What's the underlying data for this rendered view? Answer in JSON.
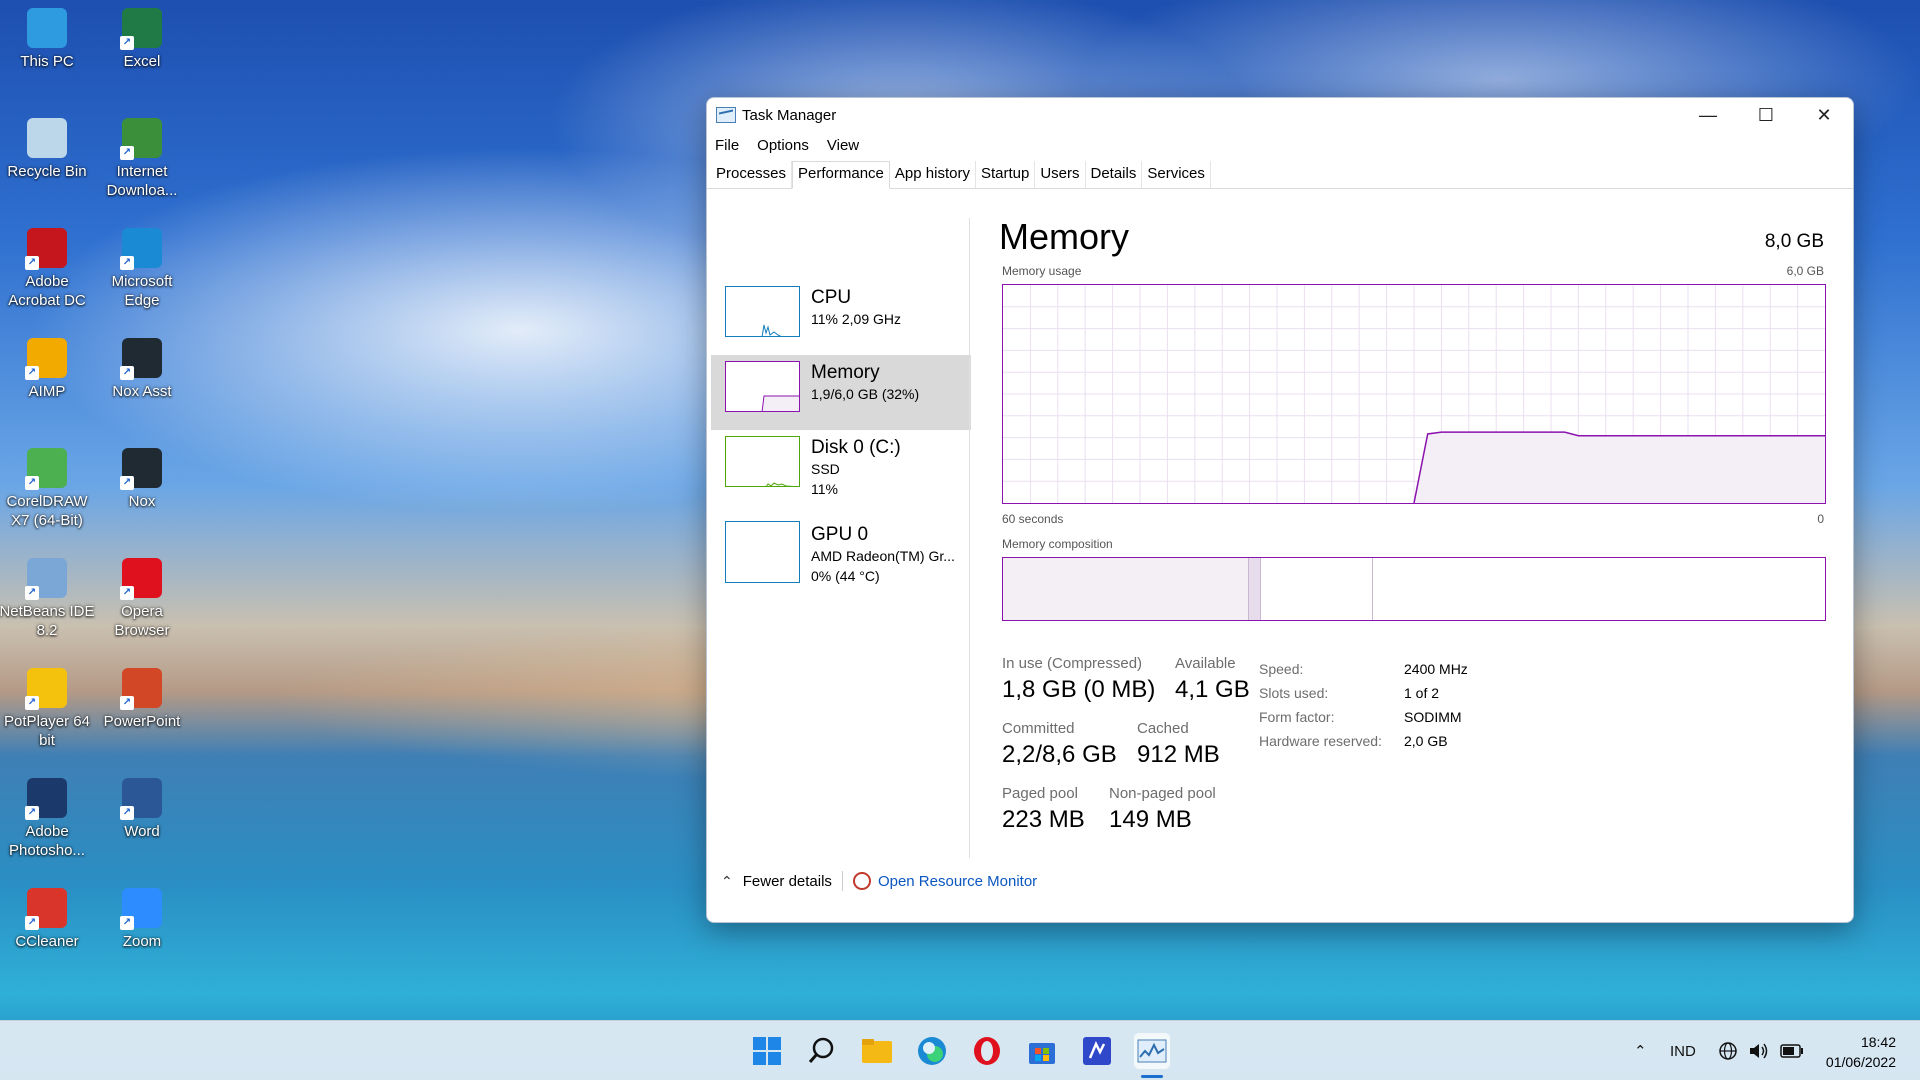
{
  "desktop": {
    "icons": [
      {
        "label": "This PC",
        "icon": "computer-icon",
        "color": "#2e9ae0"
      },
      {
        "label": "Excel",
        "icon": "excel-icon",
        "color": "#1f7a45"
      },
      {
        "label": "Recycle Bin",
        "icon": "recycle-bin-icon",
        "color": "#bcd6ea"
      },
      {
        "label": "Internet Downloa...",
        "icon": "idm-icon",
        "color": "#3b8f3b"
      },
      {
        "label": "Adobe Acrobat DC",
        "icon": "acrobat-icon",
        "color": "#c4161c"
      },
      {
        "label": "Microsoft Edge",
        "icon": "edge-icon",
        "color": "#1a8ad4"
      },
      {
        "label": "AIMP",
        "icon": "aimp-icon",
        "color": "#f2a900"
      },
      {
        "label": "Nox Asst",
        "icon": "nox-asst-icon",
        "color": "#1f2a33"
      },
      {
        "label": "CorelDRAW X7 (64-Bit)",
        "icon": "coreldraw-icon",
        "color": "#4caf50"
      },
      {
        "label": "Nox",
        "icon": "nox-icon",
        "color": "#1f2a33"
      },
      {
        "label": "NetBeans IDE 8.2",
        "icon": "netbeans-icon",
        "color": "#7aa7d6"
      },
      {
        "label": "Opera Browser",
        "icon": "opera-icon",
        "color": "#e0111f"
      },
      {
        "label": "PotPlayer 64 bit",
        "icon": "potplayer-icon",
        "color": "#f4c20d"
      },
      {
        "label": "PowerPoint",
        "icon": "powerpoint-icon",
        "color": "#d24726"
      },
      {
        "label": "Adobe Photosho...",
        "icon": "photoshop-icon",
        "color": "#1b3a6b"
      },
      {
        "label": "Word",
        "icon": "word-icon",
        "color": "#2b5797"
      },
      {
        "label": "CCleaner",
        "icon": "ccleaner-icon",
        "color": "#d9352b"
      },
      {
        "label": "Zoom",
        "icon": "zoom-icon",
        "color": "#2d8cff"
      }
    ]
  },
  "window": {
    "title": "Task Manager",
    "menu": [
      "File",
      "Options",
      "View"
    ],
    "tabs": [
      "Processes",
      "Performance",
      "App history",
      "Startup",
      "Users",
      "Details",
      "Services"
    ],
    "active_tab": "Performance",
    "resources": [
      {
        "name": "CPU",
        "line1": "11% 2,09 GHz",
        "line2": "",
        "line3": "",
        "color": "#117dbb"
      },
      {
        "name": "Memory",
        "line1": "1,9/6,0 GB (32%)",
        "line2": "",
        "line3": "",
        "color": "#8b12ae"
      },
      {
        "name": "Disk 0 (C:)",
        "line1": "SSD",
        "line2": "11%",
        "line3": "",
        "color": "#4da60c"
      },
      {
        "name": "GPU 0",
        "line1": "AMD Radeon(TM) Gr...",
        "line2": "0% (44 °C)",
        "line3": "",
        "color": "#117dbb"
      }
    ],
    "panel": {
      "heading": "Memory",
      "total": "8,0 GB",
      "usage_label": "Memory usage",
      "usage_max": "6,0 GB",
      "time_left": "60 seconds",
      "time_right": "0",
      "composition_label": "Memory composition",
      "stats": {
        "in_use_label": "In use (Compressed)",
        "in_use": "1,8 GB (0 MB)",
        "available_label": "Available",
        "available": "4,1 GB",
        "committed_label": "Committed",
        "committed": "2,2/8,6 GB",
        "cached_label": "Cached",
        "cached": "912 MB",
        "paged_label": "Paged pool",
        "paged": "223 MB",
        "nonpaged_label": "Non-paged pool",
        "nonpaged": "149 MB"
      },
      "specs": [
        {
          "k": "Speed:",
          "v": "2400 MHz"
        },
        {
          "k": "Slots used:",
          "v": "1 of 2"
        },
        {
          "k": "Form factor:",
          "v": "SODIMM"
        },
        {
          "k": "Hardware reserved:",
          "v": "2,0 GB"
        }
      ]
    },
    "footer": {
      "fewer": "Fewer details",
      "monitor": "Open Resource Monitor"
    }
  },
  "taskbar": {
    "apps": [
      "start-icon",
      "search-icon",
      "file-explorer-icon",
      "edge-icon",
      "opera-icon",
      "store-icon",
      "vscode-icon",
      "task-manager-icon"
    ],
    "lang": "IND",
    "time": "18:42",
    "date": "01/06/2022"
  },
  "chart_data": [
    {
      "type": "line",
      "title": "Memory usage",
      "xlabel": "60 seconds",
      "ylabel": "",
      "xlim": [
        60,
        0
      ],
      "ylim": [
        0,
        6.0
      ],
      "x": [
        60,
        59,
        58,
        57,
        56,
        55,
        54,
        53,
        52,
        51,
        50,
        49,
        48,
        47,
        46,
        45,
        44,
        43,
        42,
        41,
        40,
        39,
        38,
        37,
        36,
        35,
        34,
        33,
        32,
        31,
        30,
        29,
        28,
        27,
        26,
        25,
        24,
        23,
        22,
        21,
        20,
        19,
        18,
        17,
        16,
        15,
        14,
        13,
        12,
        11,
        10,
        9,
        8,
        7,
        6,
        5,
        4,
        3,
        2,
        1,
        0
      ],
      "series": [
        {
          "values": [
            null,
            null,
            null,
            null,
            null,
            null,
            null,
            null,
            null,
            null,
            null,
            null,
            null,
            null,
            null,
            null,
            null,
            null,
            null,
            null,
            null,
            null,
            null,
            null,
            null,
            null,
            null,
            null,
            null,
            null,
            0.0,
            1.9,
            1.95,
            1.95,
            1.95,
            1.95,
            1.95,
            1.95,
            1.95,
            1.95,
            1.95,
            1.95,
            1.85,
            1.85,
            1.85,
            1.85,
            1.85,
            1.85,
            1.85,
            1.85,
            1.85,
            1.85,
            1.85,
            1.85,
            1.85,
            1.85,
            1.85,
            1.85,
            1.85,
            1.85,
            1.85
          ]
        }
      ]
    }
  ]
}
